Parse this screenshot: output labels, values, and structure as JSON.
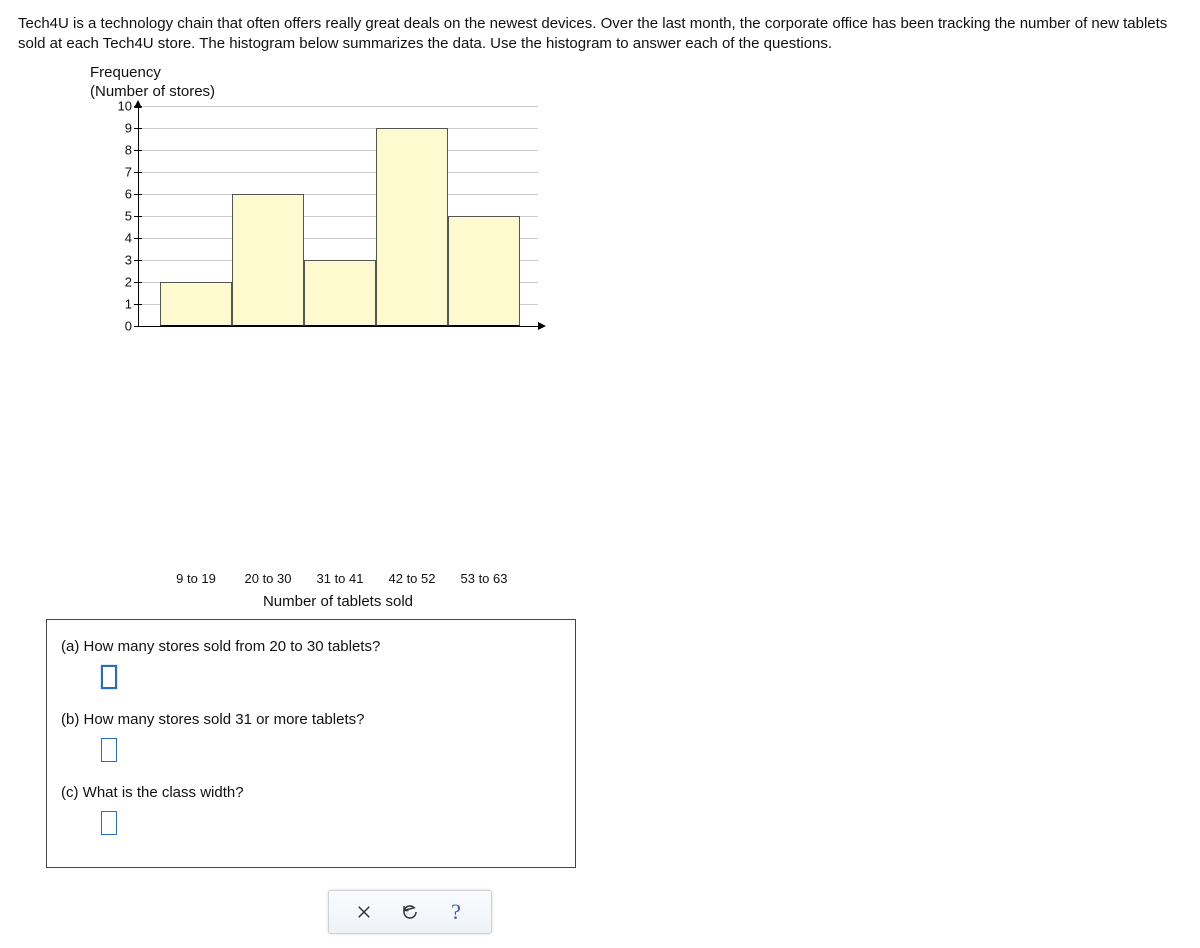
{
  "intro": "Tech4U is a technology chain that often offers really great deals on the newest devices. Over the last month, the corporate office has been tracking the number of new tablets sold at each Tech4U store. The histogram below summarizes the data. Use the histogram to answer each of the questions.",
  "chart_data": {
    "type": "bar",
    "title": "",
    "xlabel": "Number of tablets sold",
    "ylabel_line1": "Frequency",
    "ylabel_line2": "(Number of stores)",
    "categories": [
      "9 to 19",
      "20 to 30",
      "31 to 41",
      "42 to 52",
      "53 to 63"
    ],
    "values": [
      2,
      6,
      3,
      9,
      5
    ],
    "ylim": [
      0,
      10
    ],
    "yticks": [
      0,
      1,
      2,
      3,
      4,
      5,
      6,
      7,
      8,
      9,
      10
    ]
  },
  "questions": {
    "a": "(a) How many stores sold from 20 to 30 tablets?",
    "b": "(b) How many stores sold 31 or more tablets?",
    "c": "(c) What is the class width?"
  },
  "answers": {
    "a": "",
    "b": "",
    "c": ""
  },
  "toolbar": {
    "close": "×",
    "reset": "↺",
    "help": "?"
  }
}
